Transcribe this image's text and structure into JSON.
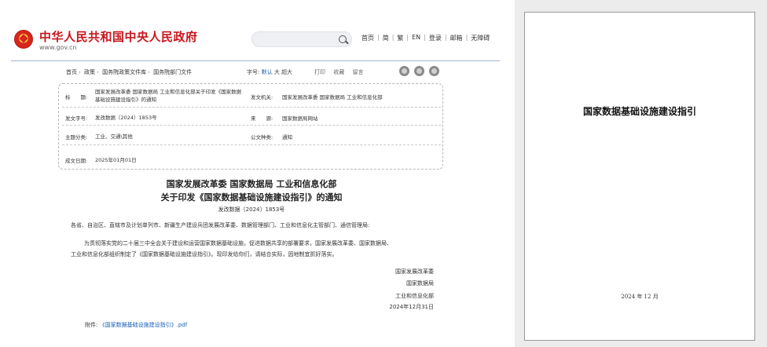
{
  "site": {
    "title": "中华人民共和国中央人民政府",
    "domain": "www.gov.cn",
    "search_placeholder": "",
    "nav": [
      "首页",
      "简",
      "繁",
      "EN",
      "登录",
      "邮箱",
      "无障碍"
    ]
  },
  "toolbar": {
    "breadcrumb": [
      "首页",
      "政策",
      "国务院政策文件库",
      "国务院部门文件"
    ],
    "font_size_label": "字号:",
    "font_default": "默认",
    "font_large": "大",
    "font_xlarge": "超大",
    "print": "打印",
    "favorite": "收藏",
    "comment": "留言"
  },
  "meta": {
    "title_label": "标　　题:",
    "title_value_line1": "国家发展改革委 国家数据局 工业和信息化部关于印发《国家数据",
    "title_value_line2": "基础设施建设指引》的通知",
    "issuer_label": "发文机关:",
    "issuer_value": "国家发展改革委 国家数据局 工业和信息化部",
    "docnum_label": "发文字号:",
    "docnum_value": "发改数据〔2024〕1853号",
    "source_label": "来　　源:",
    "source_value": "国家数据局网站",
    "topic_label": "主题分类:",
    "topic_value": "工业、交通\\其他",
    "type_label": "公文种类:",
    "type_value": "通知",
    "date_label": "成文日期:",
    "date_value": "2025年01月01日"
  },
  "document": {
    "title_line1": "国家发展改革委 国家数据局 工业和信息化部",
    "title_line2": "关于印发《国家数据基础设施建设指引》的通知",
    "number": "发改数据〔2024〕1853号",
    "recipients": "各省、自治区、直辖市及计划单列市、新疆生产建设兵团发展改革委、数据管理部门、工业和信息化主管部门、通信管理局:",
    "para1": "为贯彻落实党的二十届三中全会关于建设和运营国家数据基础设施，促进数据共享的部署要求，国家发展改革委、国家数据局、",
    "para2": "工业和信息化部组织制定了《国家数据基础设施建设指引》。现印发给你们，请结合实际，因地制宜抓好落实。",
    "signers": [
      "国家发展改革委",
      "国家数据局",
      "工业和信息化部"
    ],
    "sign_date": "2024年12月31日",
    "attachment_label": "附件:",
    "attachment_link": "《国家数据基础设施建设指引》.pdf"
  },
  "preview": {
    "title": "国家数据基础设施建设指引",
    "date": "2024 年 12 月"
  }
}
